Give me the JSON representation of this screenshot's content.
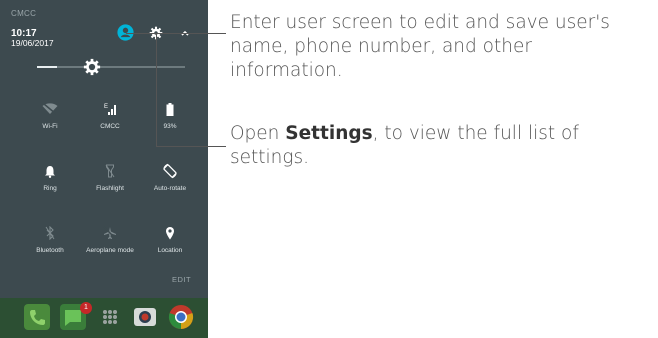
{
  "status": {
    "carrier": "CMCC",
    "time": "10:17",
    "date": "19/06/2017"
  },
  "tiles": [
    {
      "label": "Wi-Fi",
      "icon": "wifi-off-icon"
    },
    {
      "label": "CMCC",
      "icon": "signal-icon"
    },
    {
      "label": "93%",
      "icon": "battery-icon"
    },
    {
      "label": "Ring",
      "icon": "bell-icon"
    },
    {
      "label": "Flashlight",
      "icon": "flashlight-icon"
    },
    {
      "label": "Auto-rotate",
      "icon": "auto-rotate-icon"
    },
    {
      "label": "Bluetooth",
      "icon": "bluetooth-icon"
    },
    {
      "label": "Aeroplane mode",
      "icon": "airplane-icon"
    },
    {
      "label": "Location",
      "icon": "location-icon"
    }
  ],
  "edit_label": "EDIT",
  "dock": {
    "badge_count": "1"
  },
  "callouts": {
    "user": "Enter user screen to edit and save user's name, phone number, and other information.",
    "settings_pre": "Open ",
    "settings_bold": "Settings",
    "settings_post": ", to view the full list of settings."
  },
  "colors": {
    "panel": "#3d4a4f",
    "accent": "#00b4d8",
    "dock": "#2c4f33"
  }
}
